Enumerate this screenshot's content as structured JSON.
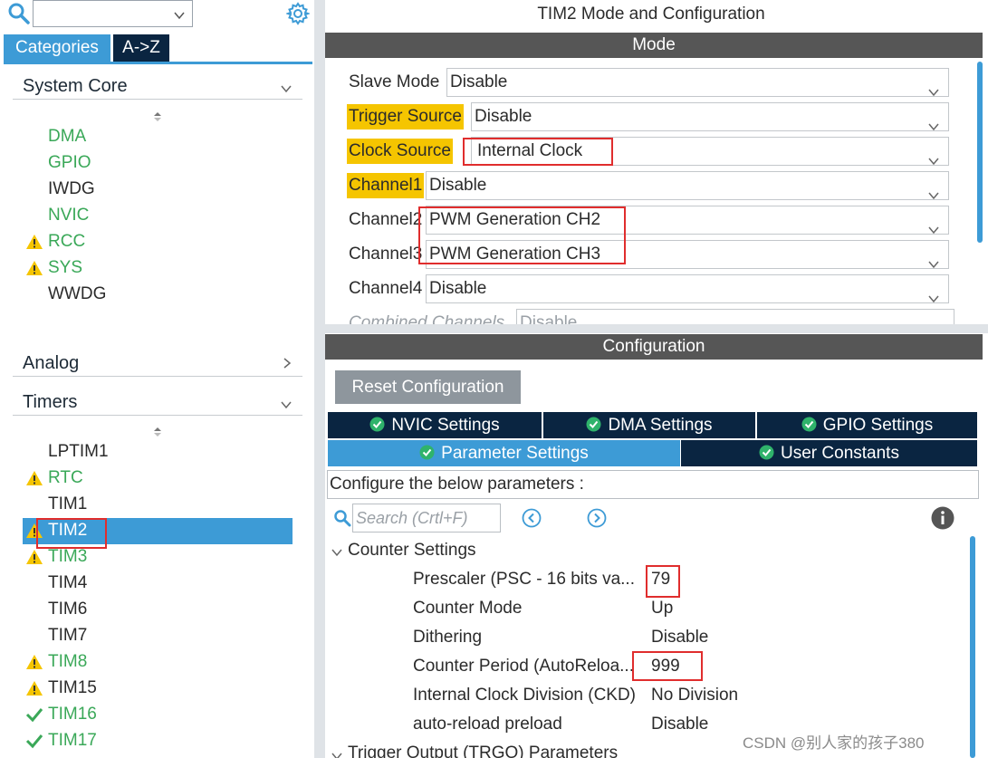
{
  "left_panel": {
    "search_value": "",
    "tabs": {
      "categories": "Categories",
      "az": "A->Z"
    },
    "system_core": {
      "label": "System Core",
      "items": [
        {
          "label": "DMA",
          "status": "ok-green",
          "icon": ""
        },
        {
          "label": "GPIO",
          "status": "ok-green",
          "icon": ""
        },
        {
          "label": "IWDG",
          "status": "default",
          "icon": ""
        },
        {
          "label": "NVIC",
          "status": "ok-green",
          "icon": ""
        },
        {
          "label": "RCC",
          "status": "warning",
          "icon": "warning-icon"
        },
        {
          "label": "SYS",
          "status": "warning",
          "icon": "warning-icon"
        },
        {
          "label": "WWDG",
          "status": "default",
          "icon": ""
        }
      ]
    },
    "analog": {
      "label": "Analog"
    },
    "timers": {
      "label": "Timers",
      "items": [
        {
          "label": "LPTIM1",
          "status": "default",
          "icon": ""
        },
        {
          "label": "RTC",
          "status": "warning",
          "icon": "warning-icon"
        },
        {
          "label": "TIM1",
          "status": "default",
          "icon": ""
        },
        {
          "label": "TIM2",
          "status": "selected-warning",
          "icon": "warning-icon"
        },
        {
          "label": "TIM3",
          "status": "warning",
          "icon": "warning-icon"
        },
        {
          "label": "TIM4",
          "status": "default",
          "icon": ""
        },
        {
          "label": "TIM6",
          "status": "default",
          "icon": ""
        },
        {
          "label": "TIM7",
          "status": "default",
          "icon": ""
        },
        {
          "label": "TIM8",
          "status": "warning",
          "icon": "warning-icon"
        },
        {
          "label": "TIM15",
          "status": "warning",
          "icon": "warning-icon"
        },
        {
          "label": "TIM16",
          "status": "check",
          "icon": "check-icon"
        },
        {
          "label": "TIM17",
          "status": "check",
          "icon": "check-icon"
        }
      ]
    }
  },
  "right_panel": {
    "title": "TIM2 Mode and Configuration",
    "mode_bar": "Mode",
    "mode_fields": [
      {
        "label": "Slave Mode",
        "value": "Disable",
        "highlighted": false
      },
      {
        "label": "Trigger Source",
        "value": "Disable",
        "highlighted": true
      },
      {
        "label": "Clock Source",
        "value": "Internal Clock",
        "highlighted": true
      },
      {
        "label": "Channel1",
        "value": "Disable",
        "highlighted": true
      },
      {
        "label": "Channel2",
        "value": "PWM Generation CH2",
        "highlighted": false
      },
      {
        "label": "Channel3",
        "value": "PWM Generation CH3",
        "highlighted": false
      },
      {
        "label": "Channel4",
        "value": "Disable",
        "highlighted": false
      },
      {
        "label": "Combined Channels",
        "value": "Disable",
        "highlighted": false
      }
    ],
    "config_bar": "Configuration",
    "reset_button": "Reset Configuration",
    "tabs": {
      "nvic": "NVIC Settings",
      "dma": "DMA Settings",
      "gpio": "GPIO Settings",
      "parameter": "Parameter Settings",
      "user_constants": "User Constants"
    },
    "description": "Configure the below parameters :",
    "search_placeholder": "Search (Crtl+F)",
    "groups": {
      "counter": "Counter Settings",
      "trigger": "Trigger Output (TRGO) Parameters"
    },
    "parameters": [
      {
        "name": "Prescaler (PSC - 16 bits va...",
        "value": "79"
      },
      {
        "name": "Counter Mode",
        "value": "Up"
      },
      {
        "name": "Dithering",
        "value": "Disable"
      },
      {
        "name": "Counter Period (AutoReloa...",
        "value": "999"
      },
      {
        "name": "Internal Clock Division (CKD)",
        "value": "No Division"
      },
      {
        "name": "auto-reload preload",
        "value": "Disable"
      }
    ]
  },
  "watermark": "CSDN @别人家的孩子380",
  "colors": {
    "accent_blue": "#3d9bd6",
    "navy": "#0a2541",
    "highlight_yellow": "#f5c500",
    "annotation_red": "#e02d2d",
    "status_green": "#3aa858"
  }
}
